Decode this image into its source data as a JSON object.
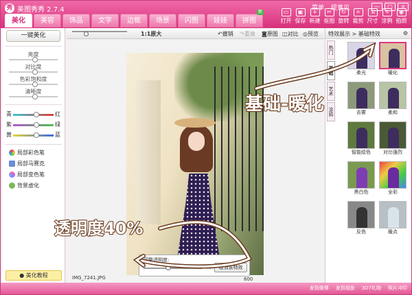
{
  "app": {
    "title": "美图秀秀 2.7.4",
    "logo_char": "秀"
  },
  "menu": {
    "items": [
      "菜单",
      "提意见"
    ]
  },
  "window_controls": [
    "—",
    "□",
    "×"
  ],
  "tabs": [
    {
      "label": "美化",
      "active": true
    },
    {
      "label": "美容"
    },
    {
      "label": "饰品"
    },
    {
      "label": "文字"
    },
    {
      "label": "边框"
    },
    {
      "label": "场景"
    },
    {
      "label": "闪图"
    },
    {
      "label": "娃娃"
    },
    {
      "label": "拼图",
      "badge": "新"
    }
  ],
  "toolbar": {
    "items": [
      "打开",
      "保存",
      "新建",
      "抠图",
      "旋转",
      "裁剪",
      "尺寸",
      "涂鸦",
      "拍照"
    ]
  },
  "left_panel": {
    "one_click": "一键美化",
    "adjust": [
      "亮度",
      "对比度",
      "色彩饱和度",
      "清晰度"
    ],
    "color_balance": [
      {
        "left": "青",
        "right": "红"
      },
      {
        "left": "紫",
        "right": "绿"
      },
      {
        "left": "黄",
        "right": "蓝"
      }
    ],
    "brushes": [
      "局部彩色笔",
      "局部马赛克",
      "局部变色笔",
      "背景虚化"
    ],
    "tutorial": "美化教程"
  },
  "canvas_toolbar": {
    "zoom": "1:1原大",
    "undo": "撤销",
    "redo": "重做",
    "original": "原图",
    "compare": "对比",
    "preview": "预览"
  },
  "canvas": {
    "filename": "IMG_7241.JPG",
    "size": "600"
  },
  "opacity": {
    "label": "调整透明度:",
    "value": "40%",
    "cancel": "取消该特效"
  },
  "right_panel": {
    "breadcrumb": "特效展示 > 基础特效",
    "vertical_tabs": [
      "热门",
      "基础",
      "艺术",
      "涂鸦"
    ],
    "effects": [
      "柔光",
      "暖化",
      "去雾",
      "柔和",
      "智能绘色",
      "对比强烈",
      "黑白色",
      "全彩",
      "反色",
      "暖点"
    ]
  },
  "status_bar": [
    "发到微博",
    "发到相册",
    "3D7礼物",
    "照片冲印"
  ],
  "annotations": {
    "top": "基础-暖化",
    "bottom": "透明度40%"
  },
  "colors": {
    "brand": "#e0357f",
    "titlebar_top": "#f06aa8",
    "titlebar_bottom": "#d8317c",
    "status_bar": "#e45896",
    "annotation_outline": "#6b3a1d"
  }
}
